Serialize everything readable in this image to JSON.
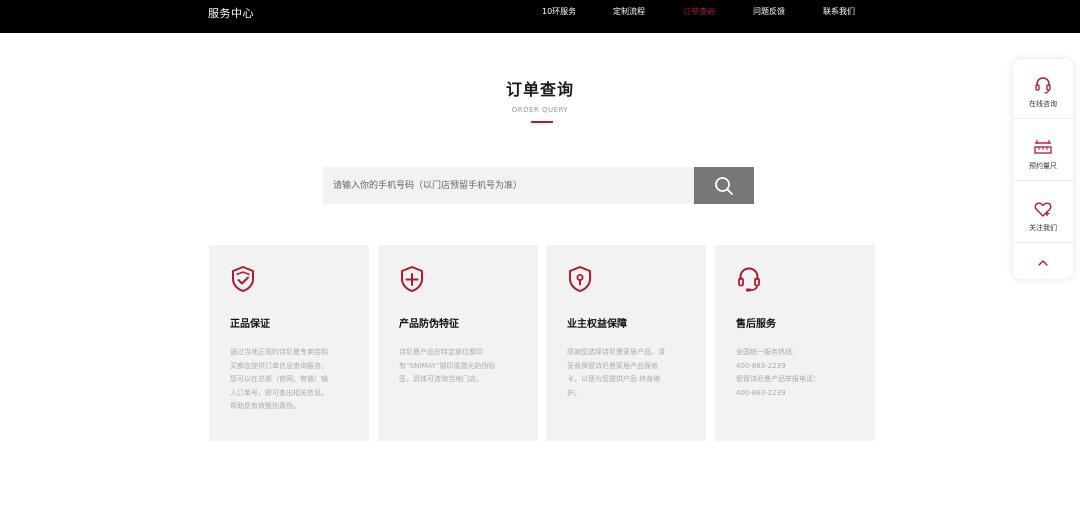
{
  "header": {
    "brand": "服务中心",
    "nav": [
      {
        "label": "10环服务",
        "active": false
      },
      {
        "label": "定制流程",
        "active": false
      },
      {
        "label": "订单查询",
        "active": true
      },
      {
        "label": "问题反馈",
        "active": false
      },
      {
        "label": "联系我们",
        "active": false
      }
    ]
  },
  "section": {
    "title": "订单查询",
    "subtitle": "ORDER QUERY"
  },
  "search": {
    "placeholder": "请输入你的手机号码（以门店预留手机号为准）",
    "value": "",
    "button_icon": "search-icon"
  },
  "cards": [
    {
      "icon": "shield-check-icon",
      "title": "正品保证",
      "lines": [
        "通过当地正规的诗尼曼专卖店购",
        "买都会提供订单信息查询服务，",
        "您可以在总部（官网、官微）输",
        "入订单号，即可查出相关信息，",
        "帮助您有效甄别真伪。"
      ]
    },
    {
      "icon": "shield-plus-icon",
      "title": "产品防伪特征",
      "lines": [
        "诗尼曼产品在特定部位都印",
        "有“SNIMAY”钢印或激光防伪标",
        "签，具体可咨询当地门店。"
      ]
    },
    {
      "icon": "shield-lock-icon",
      "title": "业主权益保障",
      "lines": [
        "感谢您选择诗尼曼家居产品，请",
        "妥善保管诗尼曼家居产品保修",
        "卡，以便为您提供产品 终身维",
        "护。"
      ]
    },
    {
      "icon": "headset-icon",
      "title": "售后服务",
      "lines": [
        "全国统一服务热线：",
        "400-883-2239",
        "假冒诗尼曼产品举报电话：",
        "400-883-2239"
      ]
    }
  ],
  "side": {
    "items": [
      {
        "label": "在线咨询",
        "icon": "headset-icon"
      },
      {
        "label": "预约量尺",
        "icon": "ruler-icon"
      },
      {
        "label": "关注我们",
        "icon": "heart-plus-icon"
      }
    ],
    "top_icon": "chevron-up-icon"
  },
  "colors": {
    "accent": "#b0192f",
    "header_bg": "#000000",
    "card_bg": "#f2f2f2",
    "search_button_bg": "#777777"
  }
}
